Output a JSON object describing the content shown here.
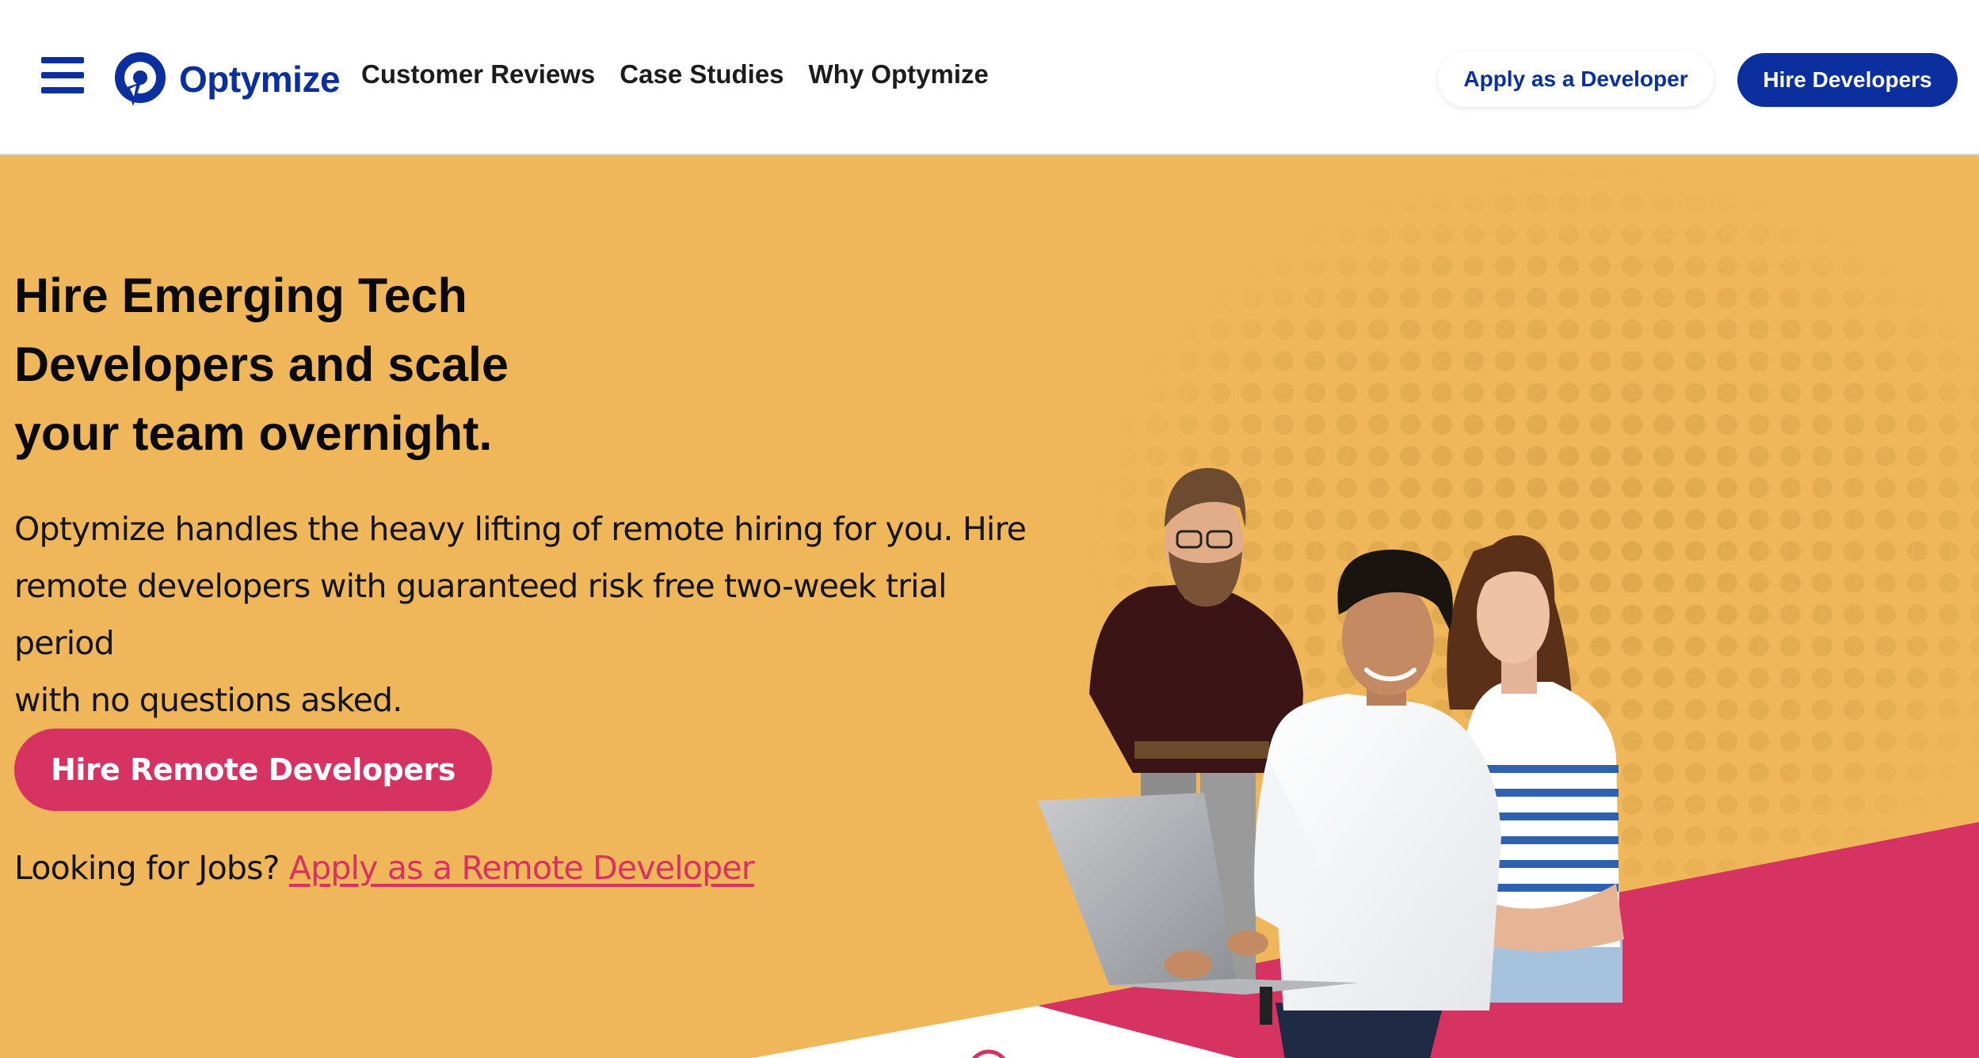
{
  "header": {
    "logo_text": "Optymize",
    "nav": [
      {
        "label": "Customer Reviews"
      },
      {
        "label": "Case Studies"
      },
      {
        "label": "Why Optymize"
      }
    ],
    "apply_button": "Apply as a Developer",
    "hire_button": "Hire Developers"
  },
  "hero": {
    "headline_lines": [
      "Hire Emerging Tech",
      "Developers and scale",
      "your team overnight."
    ],
    "subtext_lines": [
      "Optymize handles the heavy lifting of remote hiring for you. Hire",
      "remote developers with guaranteed risk free two-week trial period",
      "with no questions asked."
    ],
    "cta_label": "Hire Remote Developers",
    "jobs_prompt": "Looking for Jobs?",
    "jobs_link": "Apply as a Remote Developer"
  },
  "icons": {
    "menu": "hamburger-menu-icon",
    "logo": "optymize-logo-icon"
  },
  "colors": {
    "brand_blue": "#0b2f9e",
    "hero_yellow": "#efb75a",
    "accent_pink": "#d63262",
    "text_dark": "#141414"
  }
}
